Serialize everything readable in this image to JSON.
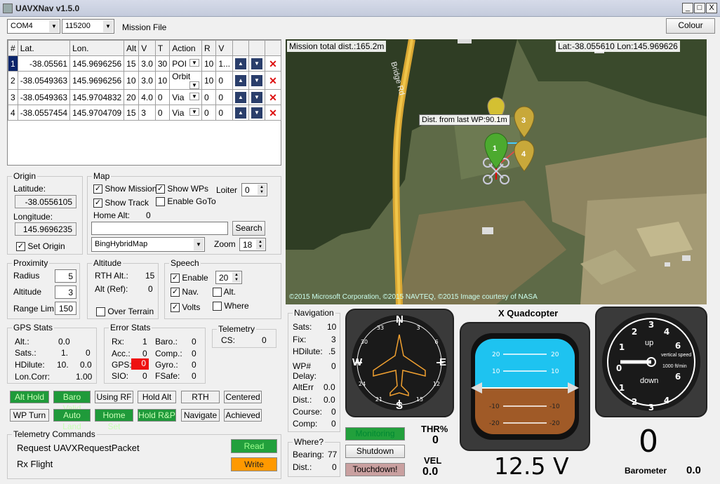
{
  "window": {
    "title": "UAVXNav  v1.5.0",
    "min": "_",
    "max": "□",
    "close": "X"
  },
  "toolbar": {
    "com_port": "COM4",
    "baud": "115200",
    "mission_file": "Mission File",
    "colour": "Colour"
  },
  "waypoints": {
    "headers": [
      "#",
      "Lat.",
      "Lon.",
      "Alt",
      "V",
      "T",
      "Action",
      "R",
      "V"
    ],
    "rows": [
      {
        "n": "1",
        "lat": "-38.05561",
        "lon": "145.9696256",
        "alt": "15",
        "v": "3.0",
        "t": "30",
        "action": "POI",
        "r": "10",
        "v2": "1..."
      },
      {
        "n": "2",
        "lat": "-38.0549363",
        "lon": "145.9696256",
        "alt": "10",
        "v": "3.0",
        "t": "10",
        "action": "Orbit",
        "r": "10",
        "v2": "0"
      },
      {
        "n": "3",
        "lat": "-38.0549363",
        "lon": "145.9704832",
        "alt": "20",
        "v": "4.0",
        "t": "0",
        "action": "Via",
        "r": "0",
        "v2": "0"
      },
      {
        "n": "4",
        "lat": "-38.0557454",
        "lon": "145.9704709",
        "alt": "15",
        "v": "3",
        "t": "0",
        "action": "Via",
        "r": "0",
        "v2": "0"
      }
    ]
  },
  "origin": {
    "title": "Origin",
    "lat_label": "Latitude:",
    "lat": "-38.0556105",
    "lon_label": "Longitude:",
    "lon": "145.9696235",
    "set_origin": "Set Origin"
  },
  "map_opts": {
    "title": "Map",
    "show_mission": "Show Mission",
    "show_wps": "Show WPs",
    "loiter": "Loiter",
    "loiter_val": "0",
    "show_track": "Show Track",
    "enable_goto": "Enable GoTo",
    "home_alt": "Home Alt:",
    "home_alt_val": "0",
    "search": "Search",
    "provider": "BingHybridMap",
    "zoom": "Zoom",
    "zoom_val": "18"
  },
  "proximity": {
    "title": "Proximity",
    "radius": "Radius",
    "radius_val": "5",
    "altitude": "Altitude",
    "altitude_val": "3",
    "range": "Range Lim.",
    "range_val": "150"
  },
  "altitude": {
    "title": "Altitude",
    "rth": "RTH Alt.:",
    "rth_val": "15",
    "alt_ref": "Alt (Ref):",
    "alt_ref_val": "0",
    "over_terrain": "Over Terrain"
  },
  "speech": {
    "title": "Speech",
    "enable": "Enable",
    "enable_val": "20",
    "nav": "Nav.",
    "alt": "Alt.",
    "volts": "Volts",
    "where": "Where"
  },
  "gps": {
    "title": "GPS Stats",
    "alt": "Alt.:",
    "alt_val": "0.0",
    "sats": "Sats.:",
    "sats_val": "1.",
    "sats_val2": "0",
    "hd": "HDilute:",
    "hd_val": "10.",
    "hd_val2": "0.0",
    "lon": "Lon.Corr:",
    "lon_val": "1.00"
  },
  "errors": {
    "title": "Error Stats",
    "rx": "Rx:",
    "rx_val": "1",
    "baro": "Baro.:",
    "baro_val": "0",
    "acc": "Acc.:",
    "acc_val": "0",
    "comp": "Comp.:",
    "comp_val": "0",
    "gps": "GPS:",
    "gps_val": "0",
    "gyro": "Gyro.:",
    "gyro_val": "0",
    "sio": "SIO:",
    "sio_val": "0",
    "fsafe": "FSafe:",
    "fsafe_val": "0"
  },
  "telemetry": {
    "title": "Telemetry",
    "cs": "CS:",
    "cs_val": "0"
  },
  "status_row1": [
    "Alt Hold",
    "Baro Valid",
    "Using RF",
    "Hold Alt",
    "RTH",
    "Centered"
  ],
  "status_row2": [
    "WP Turn",
    "Auto Land",
    "Home Set",
    "Hold R&P",
    "Navigate",
    "Achieved"
  ],
  "telecmd": {
    "title": "Telemetry Commands",
    "request": "Request UAVXRequestPacket",
    "rx": "Rx Flight",
    "read": "Read",
    "write": "Write"
  },
  "map": {
    "total": "Mission total dist.:165.2m",
    "coords": "Lat:-38.055610 Lon:145.969626",
    "tooltip": "Dist. from last WP:90.1m",
    "road": "Bridge Rd",
    "copyright": "©2015 Microsoft Corporation, ©2015 NAVTEQ, ©2015 Image courtesy of NASA",
    "markers": [
      "1",
      "3",
      "4"
    ]
  },
  "navigation": {
    "title": "Navigation",
    "sats": "Sats:",
    "sats_val": "10",
    "fix": "Fix:",
    "fix_val": "3",
    "hd": "HDilute:",
    "hd_val": ".5",
    "wp": "WP#",
    "wp_val": "0",
    "delay": "Delay:",
    "alterr": "AltErr",
    "alterr_val": "0.0",
    "dist": "Dist.:",
    "dist_val": "0.0",
    "course": "Course:",
    "course_val": "0",
    "comp": "Comp:",
    "comp_val": "0"
  },
  "where": {
    "title": "Where?",
    "bearing": "Bearing:",
    "bearing_val": "77",
    "dist": "Dist.:",
    "dist_val": "0"
  },
  "controls": {
    "monitoring": "Monitoring",
    "shutdown": "Shutdown",
    "touchdown": "Touchdown!"
  },
  "instruments": {
    "thr": "THR%",
    "thr_val": "0",
    "vel": "VEL",
    "vel_val": "0.0",
    "airframe": "X Quadcopter",
    "volts": "12.5 V",
    "big_zero": "0",
    "barometer": "Barometer",
    "baro_val": "0.0",
    "vsi_up": "up",
    "vsi_down": "down",
    "vsi_label": "vertical speed",
    "vsi_unit": "1000 ft/min"
  },
  "compass": {
    "N": "N",
    "E": "E",
    "S": "S",
    "W": "W"
  },
  "colors": {
    "on": "#22a03c",
    "on_text": "#b8ffb0",
    "gps_err": "#ee1111",
    "read": "#22a03c",
    "write": "#ff9900"
  }
}
